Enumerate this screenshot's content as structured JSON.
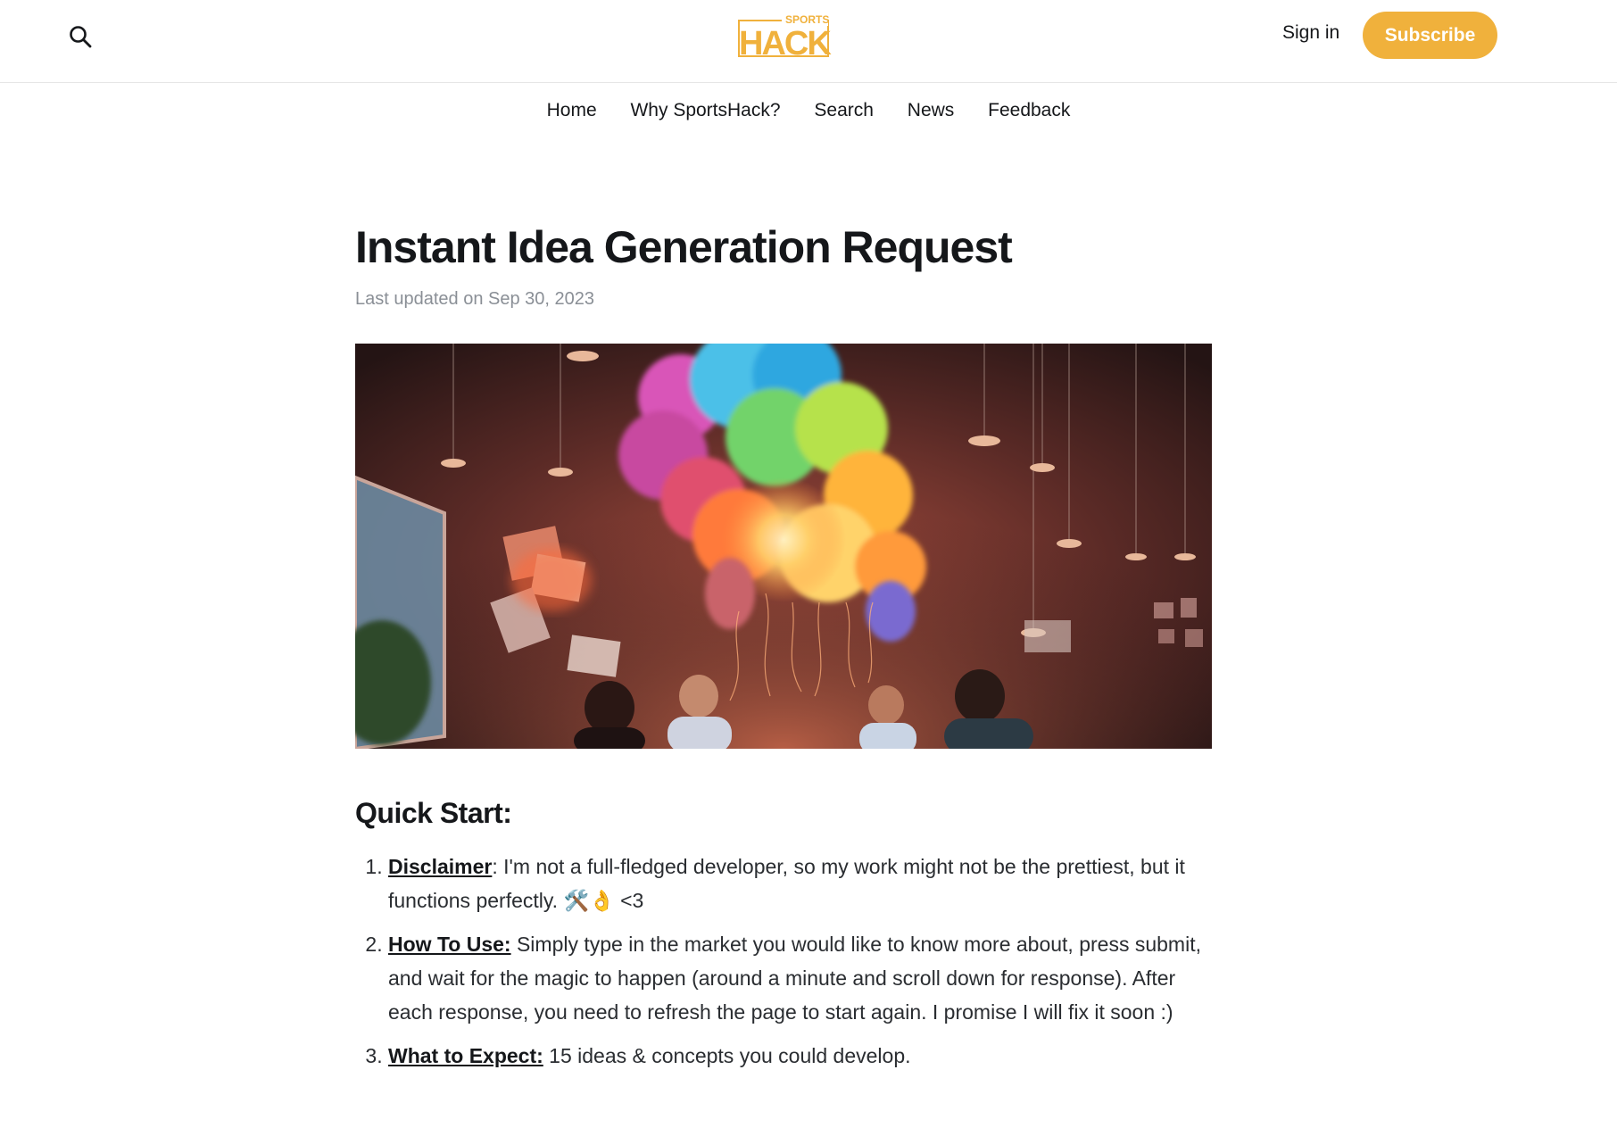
{
  "header": {
    "logo_top": "SPORTS",
    "logo_main": "HACK",
    "signin_label": "Sign in",
    "subscribe_label": "Subscribe",
    "accent_color": "#f0b13c"
  },
  "nav": {
    "items": [
      "Home",
      "Why SportsHack?",
      "Search",
      "News",
      "Feedback"
    ]
  },
  "article": {
    "title": "Instant Idea Generation Request",
    "updated": "Last updated on Sep 30, 2023",
    "section_heading": "Quick Start:",
    "steps": [
      {
        "lead": "Disclaimer",
        "text": ": I'm not a full-fledged developer, so my work might not be the prettiest, but it functions perfectly. 🛠️👌 <3"
      },
      {
        "lead": "How To Use:",
        "text": " Simply type in the market you would like to know more about, press submit, and wait for the magic to happen (around a minute and scroll down for response). After each response, you need to refresh the page to start again. I promise I will fix it soon :)"
      },
      {
        "lead": "What to Expect:",
        "text": " 15 ideas & concepts you could develop."
      }
    ]
  }
}
